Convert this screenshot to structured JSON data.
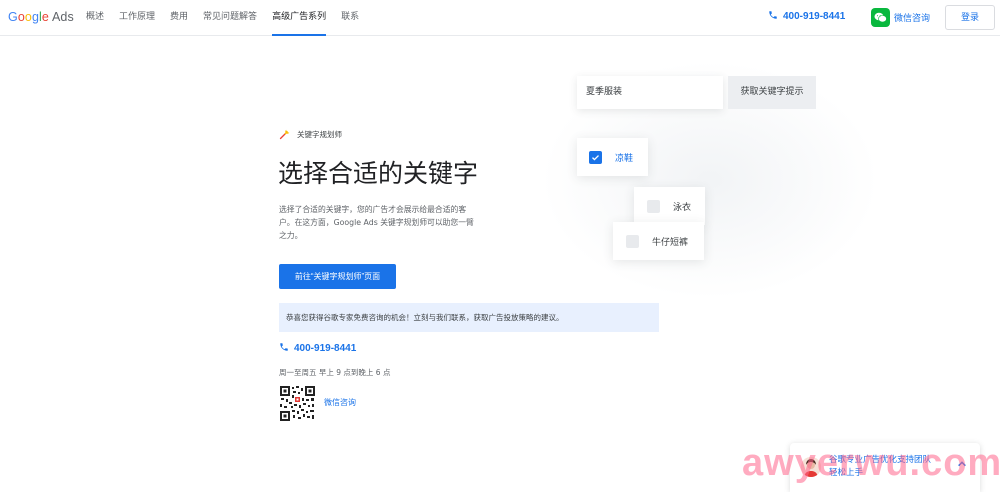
{
  "header": {
    "logo_letters": [
      "G",
      "o",
      "o",
      "g",
      "l",
      "e"
    ],
    "logo_product": "Ads",
    "nav": [
      "概述",
      "工作原理",
      "费用",
      "常见问题解答",
      "高级广告系列",
      "联系"
    ],
    "active_nav": "高级广告系列",
    "phone": "400-919-8441",
    "wechat_label": "微信咨询",
    "login_label": "登录"
  },
  "main": {
    "tag_label": "关键字规划师",
    "title": "选择合适的关键字",
    "desc_line1": "选择了合适的关键字，您的广告才会展示给最合适的客",
    "desc_line2": "户。在这方面，Google Ads 关键字规划师可以助您一臂",
    "desc_line3": "之力。",
    "cta_label": "前往“关键字规划师”页面",
    "promo": "恭喜您获得谷歌专家免费咨询的机会！立刻与我们联系，获取广告投放策略的建议。",
    "phone": "400-919-8441",
    "hours": "周一至周五 早上 9 点到晚上 6 点",
    "wechat_link": "微信咨询"
  },
  "illustration": {
    "search_value": "夏季服装",
    "search_button": "获取关键字提示",
    "chips": [
      {
        "label": "凉鞋",
        "checked": true
      },
      {
        "label": "泳衣",
        "checked": false
      },
      {
        "label": "牛仔短裤",
        "checked": false
      }
    ]
  },
  "support_widget": {
    "line1": "谷歌专业广告优化支持团队",
    "line2": "轻松上手"
  },
  "watermark": "awyerwu.com",
  "colors": {
    "accent": "#1a73e8",
    "promo_bg": "#e8f0fe",
    "wechat_green": "#09b83e"
  }
}
